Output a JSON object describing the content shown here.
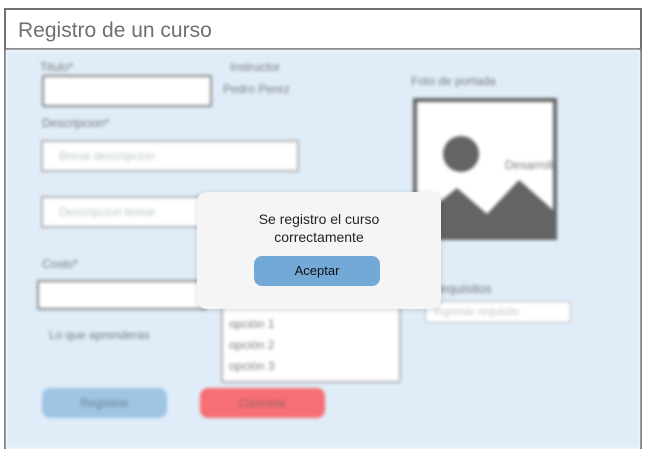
{
  "window": {
    "title": "Registro de un curso"
  },
  "form": {
    "titulo_label": "Titulo*",
    "instructor_label": "Instructor",
    "instructor_value": "Pedro Perez",
    "descripcion_label": "Descripcion*",
    "descripcion_placeholder": "Breve descripcion",
    "descripcion_breve_placeholder": "Descripcion breve",
    "costo_label": "Costo*",
    "aprenderas_label": "Lo que aprenderas",
    "options": [
      "opción 1",
      "opción 2",
      "opción 3"
    ],
    "foto_label": "Foto de portada",
    "image_caption": "Desarrollo",
    "requisitos_label": "Requisitos",
    "requisito_placeholder": "Ingresar requisito",
    "registrar_label": "Registrar",
    "cancelar_label": "Cancelar",
    "colors": {
      "registrar": "#6aa6d6",
      "cancelar": "#f2222a",
      "background": "#cfe3f5"
    }
  },
  "dialog": {
    "message_line1": "Se registro el curso",
    "message_line2": "correctamente",
    "accept_label": "Aceptar",
    "accept_color": "#73a9d6"
  }
}
